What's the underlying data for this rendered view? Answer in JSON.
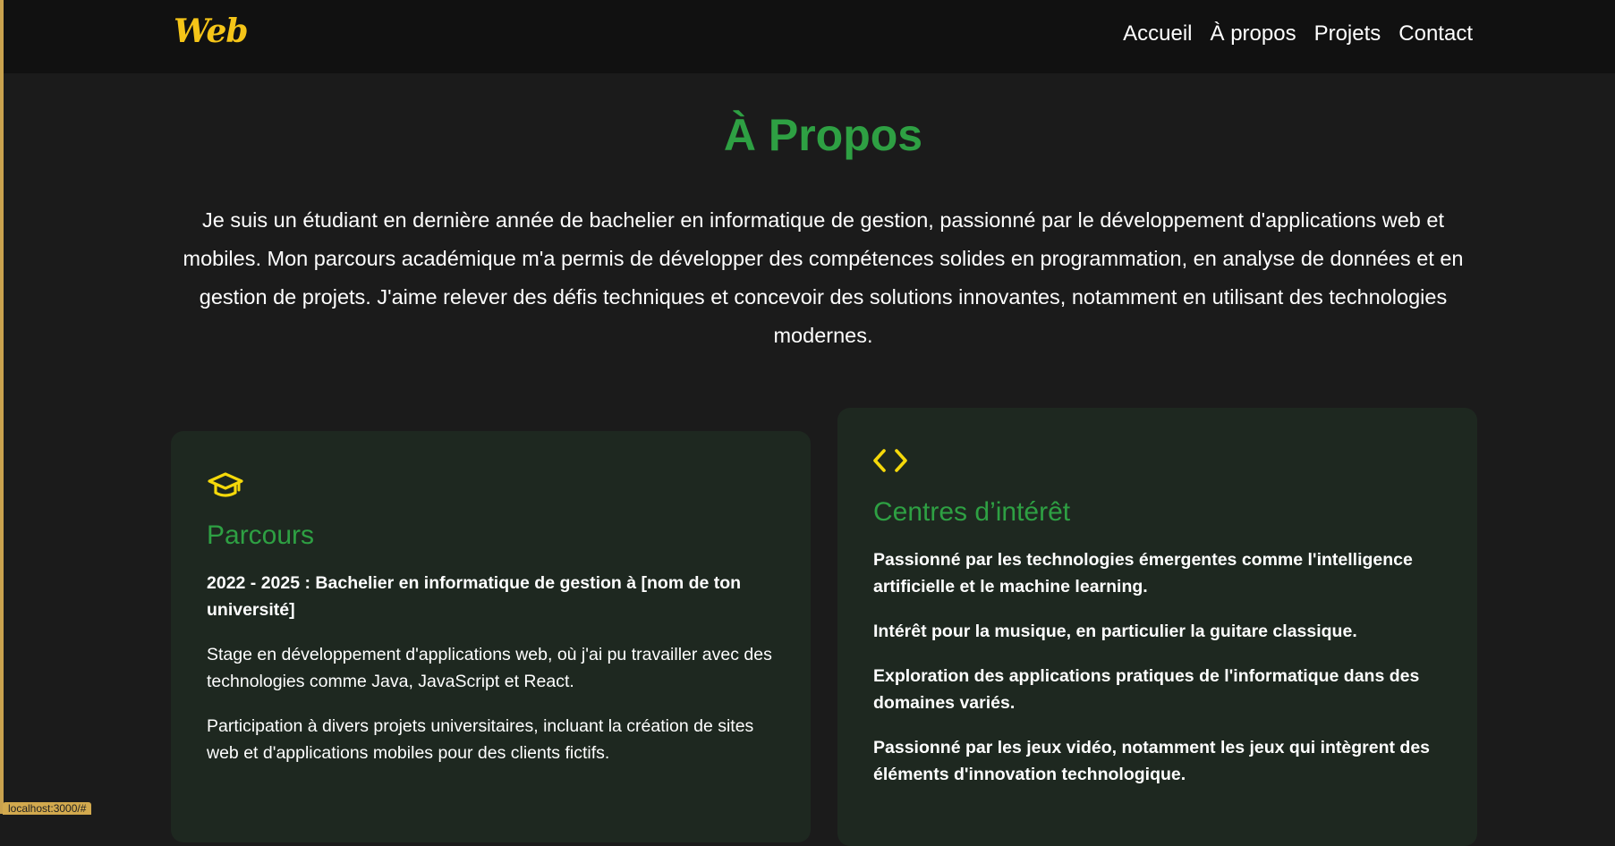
{
  "header": {
    "logo": "Web",
    "nav": [
      "Accueil",
      "À propos",
      "Projets",
      "Contact"
    ]
  },
  "main": {
    "title": "À Propos",
    "intro": "Je suis un étudiant en dernière année de bachelier en informatique de gestion, passionné par le développement d'applications web et mobiles. Mon parcours académique m'a permis de développer des compétences solides en programmation, en analyse de données et en gestion de projets. J'aime relever des défis techniques et concevoir des solutions innovantes, notamment en utilisant des technologies modernes."
  },
  "cards": {
    "parcours": {
      "icon": "graduation-cap-icon",
      "title": "Parcours",
      "items": [
        "2022 - 2025 : Bachelier en informatique de gestion à [nom de ton université]",
        "Stage en développement d'applications web, où j'ai pu travailler avec des technologies comme Java, JavaScript et React.",
        "Participation à divers projets universitaires, incluant la création de sites web et d'applications mobiles pour des clients fictifs."
      ]
    },
    "interets": {
      "icon": "code-icon",
      "title": "Centres d’intérêt",
      "items": [
        "Passionné par les technologies émergentes comme l'intelligence artificielle et le machine learning.",
        "Intérêt pour la musique, en particulier la guitare classique.",
        "Exploration des applications pratiques de l'informatique dans des domaines variés.",
        "Passionné par les jeux vidéo, notamment les jeux qui intègrent des éléments d'innovation technologique."
      ]
    }
  },
  "status_bar": {
    "url": "localhost:3000/#"
  },
  "colors": {
    "accent_green": "#2ea043",
    "logo_yellow": "#f5c518",
    "icon_yellow": "#f5d90a",
    "card_bg": "#1e2820",
    "page_bg": "#1b1b1b"
  }
}
